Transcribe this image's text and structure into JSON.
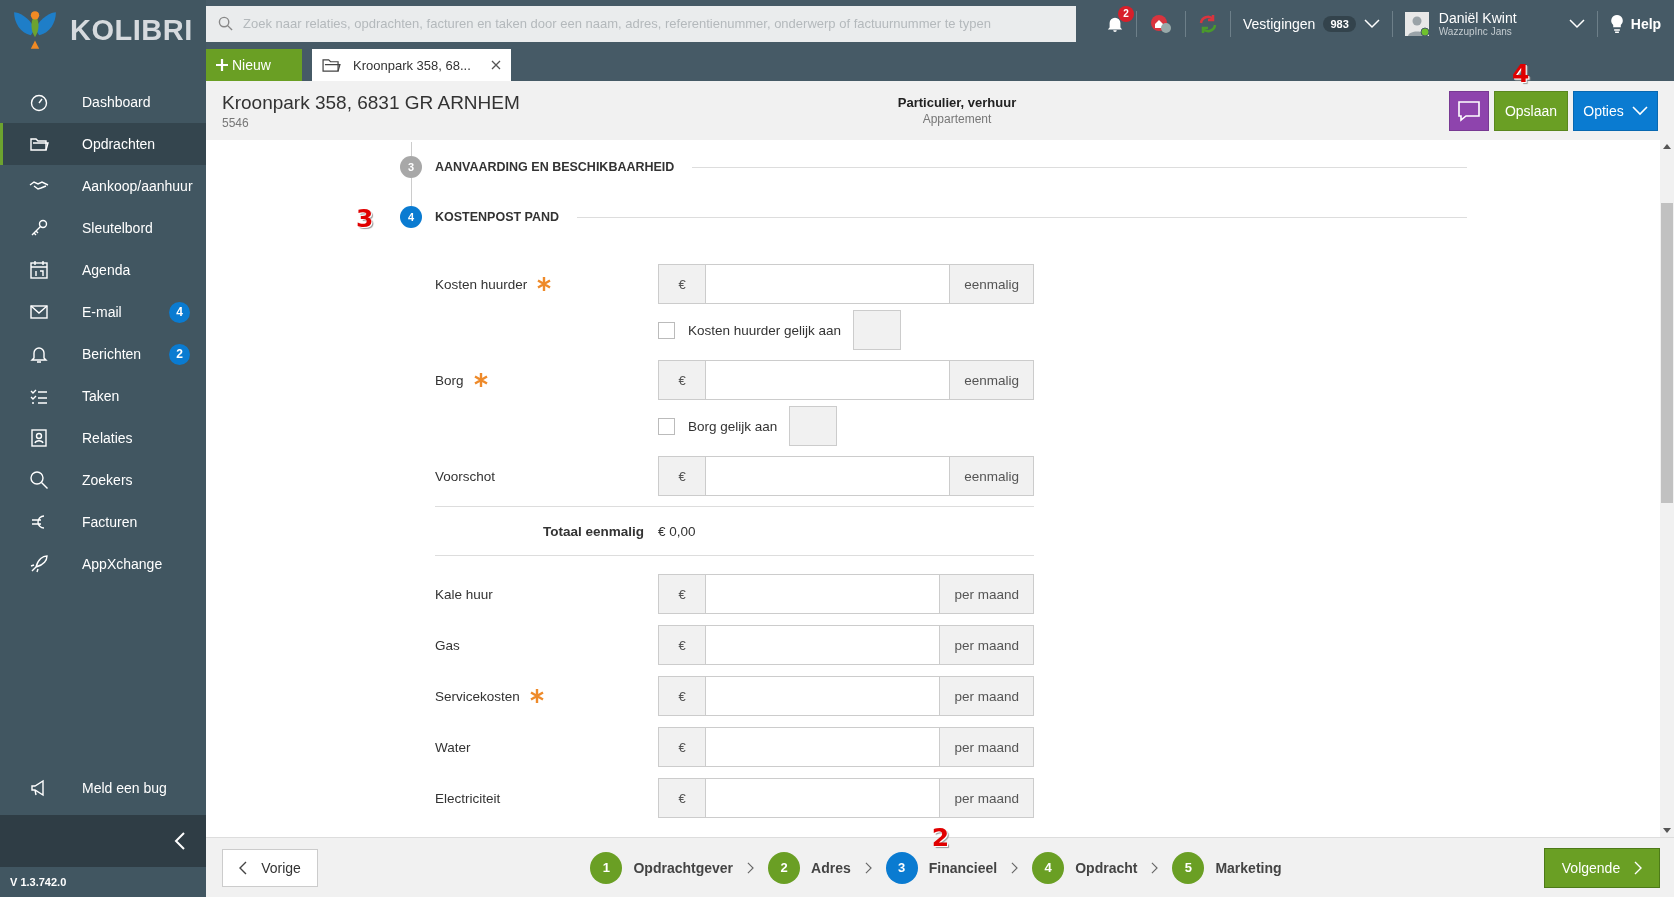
{
  "app": {
    "logo_text": "KOLIBRI",
    "version": "V 1.3.742.0"
  },
  "sidebar": {
    "items": [
      {
        "label": "Dashboard",
        "selected": false
      },
      {
        "label": "Opdrachten",
        "selected": true
      },
      {
        "label": "Aankoop/aanhuur",
        "selected": false
      },
      {
        "label": "Sleutelbord",
        "selected": false
      },
      {
        "label": "Agenda",
        "selected": false
      },
      {
        "label": "E-mail",
        "selected": false,
        "badge": "4"
      },
      {
        "label": "Berichten",
        "selected": false,
        "badge": "2"
      },
      {
        "label": "Taken",
        "selected": false
      },
      {
        "label": "Relaties",
        "selected": false
      },
      {
        "label": "Zoekers",
        "selected": false
      },
      {
        "label": "Facturen",
        "selected": false
      },
      {
        "label": "AppXchange",
        "selected": false
      }
    ],
    "bottom_item": {
      "label": "Meld een bug"
    }
  },
  "search": {
    "placeholder": "Zoek naar relaties, opdrachten, facturen en taken door een naam, adres, referentienummer, onderwerp of factuurnummer te typen"
  },
  "topbar": {
    "notification_count": "2",
    "branches_label": "Vestigingen",
    "branches_count": "983",
    "user_name": "Daniël Kwint",
    "user_company": "WazzupInc Jans",
    "help": "Help"
  },
  "tabs": {
    "new_button": "Nieuw",
    "items": [
      {
        "label": "Kroonpark 358, 68...",
        "selected": true
      }
    ]
  },
  "header": {
    "title": "Kroonpark 358, 6831 GR ARNHEM",
    "subtitle": "5546",
    "type": "Particulier, verhuur",
    "category": "Appartement",
    "buttons": [
      {
        "kind": "chat"
      },
      {
        "kind": "save",
        "label": "Opslaan",
        "callout": "4"
      },
      {
        "kind": "options",
        "label": "Opties"
      }
    ]
  },
  "sections": [
    {
      "number": "3",
      "title": "AANVAARDING EN BESCHIKBAARHEID",
      "selected": false
    },
    {
      "number": "4",
      "title": "KOSTENPOST PAND",
      "selected": true,
      "callout": "3"
    }
  ],
  "form_rows": [
    {
      "kind": "field",
      "label": "Kosten huurder",
      "required": true,
      "prefix": "€",
      "suffix": "eenmalig"
    },
    {
      "kind": "checkbox",
      "label": "Kosten huurder gelijk aan",
      "checked": false
    },
    {
      "kind": "field",
      "label": "Borg",
      "required": true,
      "prefix": "€",
      "suffix": "eenmalig"
    },
    {
      "kind": "checkbox",
      "label": "Borg gelijk aan",
      "checked": false
    },
    {
      "kind": "field",
      "label": "Voorschot",
      "required": false,
      "prefix": "€",
      "suffix": "eenmalig"
    },
    {
      "kind": "total",
      "label": "Totaal eenmalig",
      "value": "€ 0,00"
    },
    {
      "kind": "field",
      "label": "Kale huur",
      "required": false,
      "prefix": "€",
      "suffix": "per maand"
    },
    {
      "kind": "field",
      "label": "Gas",
      "required": false,
      "prefix": "€",
      "suffix": "per maand"
    },
    {
      "kind": "field",
      "label": "Servicekosten",
      "required": true,
      "prefix": "€",
      "suffix": "per maand"
    },
    {
      "kind": "field",
      "label": "Water",
      "required": false,
      "prefix": "€",
      "suffix": "per maand"
    },
    {
      "kind": "field",
      "label": "Electriciteit",
      "required": false,
      "prefix": "€",
      "suffix": "per maand"
    }
  ],
  "footer": {
    "previous": "Vorige",
    "next": "Volgende",
    "steps": [
      {
        "number": "1",
        "label": "Opdrachtgever",
        "selected": false
      },
      {
        "number": "2",
        "label": "Adres",
        "selected": false
      },
      {
        "number": "3",
        "label": "Financieel",
        "selected": true,
        "callout": "2"
      },
      {
        "number": "4",
        "label": "Opdracht",
        "selected": false
      },
      {
        "number": "5",
        "label": "Marketing",
        "selected": false
      }
    ]
  }
}
